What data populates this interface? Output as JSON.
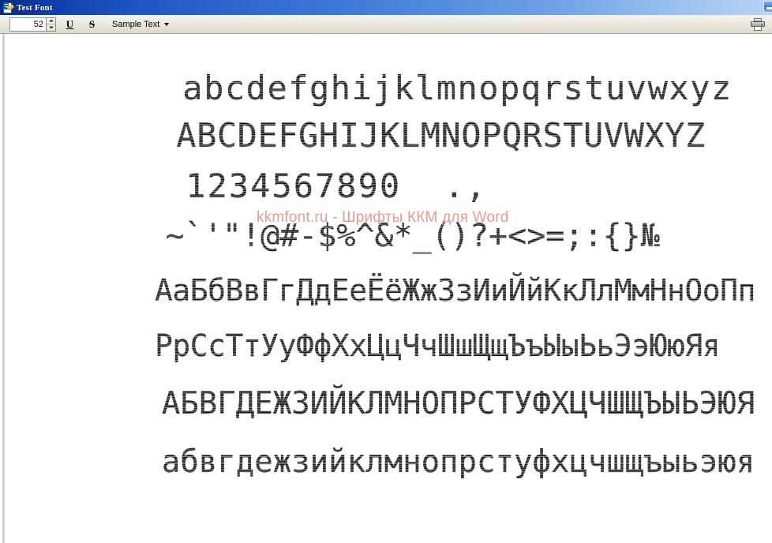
{
  "window": {
    "title": "Test Font",
    "icon": "font-document-icon",
    "controls": [
      {
        "name": "minimize-button",
        "label": "_"
      }
    ]
  },
  "toolbar": {
    "font_size": {
      "value": "52",
      "placeholder": "",
      "spinner_up": "increase-size",
      "spinner_down": "decrease-size"
    },
    "underline_label": "U",
    "strikethrough_label": "S",
    "sample_text_label": "Sample Text",
    "print_icon": "printer-icon",
    "dropdown_icon": "caret-down-icon"
  },
  "sample": {
    "lines": [
      {
        "id": "lowercase-latin",
        "text": "abcdefghijklmnopqrstuvwxyz"
      },
      {
        "id": "uppercase-latin",
        "text": "ABCDEFGHIJKLMNOPQRSTUVWXYZ"
      },
      {
        "id": "digits",
        "text": "1234567890  .,"
      },
      {
        "id": "symbols",
        "text": "~`'\"!@#-$%^&*_()?+<>=;:{}№"
      },
      {
        "id": "cyrillic-pairs-1",
        "text": "АаБбВвГгДдЕеЁёЖжЗзИиЙйКкЛлМмНнОоПп"
      },
      {
        "id": "cyrillic-pairs-2",
        "text": "РрСсТтУуФфХхЦцЧчШшЩщЪъЫыЬьЭэЮюЯя"
      },
      {
        "id": "cyrillic-uppercase",
        "text": "АБВГДЕЖЗИЙКЛМНОПРСТУФХЦЧШЩЪЫЬЭЮЯ"
      },
      {
        "id": "cyrillic-lowercase",
        "text": "абвгдежзийклмнопрстуфхцчшщъыьэюя"
      }
    ],
    "watermark": "kkmfont.ru - Шрифты ККМ для Word"
  },
  "colors": {
    "titlebar_start": "#0a2a7a",
    "titlebar_end": "#b8d4f4",
    "toolbar_bg": "#ebe9e0",
    "canvas_bg": "#ffffff",
    "text": "#1a1a1a",
    "watermark": "#e79b93"
  }
}
